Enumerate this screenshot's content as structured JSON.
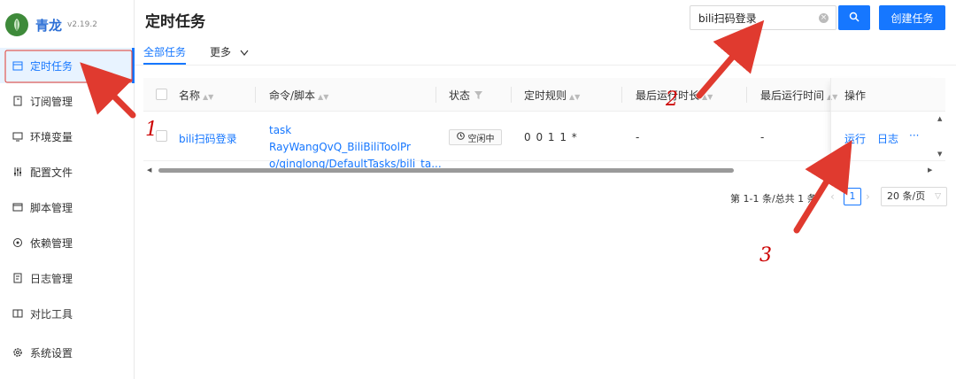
{
  "brand": {
    "name": "青龙",
    "version": "v2.19.2"
  },
  "sidebar": {
    "items": [
      {
        "label": "定时任务",
        "icon": "calendar-icon",
        "active": true
      },
      {
        "label": "订阅管理",
        "icon": "subscription-icon"
      },
      {
        "label": "环境变量",
        "icon": "monitor-icon"
      },
      {
        "label": "配置文件",
        "icon": "sliders-icon"
      },
      {
        "label": "脚本管理",
        "icon": "code-window-icon"
      },
      {
        "label": "依赖管理",
        "icon": "dependency-icon"
      },
      {
        "label": "日志管理",
        "icon": "log-icon"
      },
      {
        "label": "对比工具",
        "icon": "compare-icon"
      },
      {
        "label": "系统设置",
        "icon": "gear-icon"
      }
    ]
  },
  "header": {
    "title": "定时任务",
    "search_value": "bili扫码登录",
    "create_label": "创建任务"
  },
  "tabs": {
    "all": "全部任务",
    "more": "更多"
  },
  "table": {
    "columns": {
      "name": "名称",
      "command": "命令/脚本",
      "status": "状态",
      "schedule": "定时规则",
      "last_duration": "最后运行时长",
      "last_run": "最后运行时间",
      "actions": "操作"
    },
    "rows": [
      {
        "name": "bili扫码登录",
        "command_line1": "task RayWangQvQ_BiliBiliToolPr",
        "command_line2": "o/qinglong/DefaultTasks/bili_ta...",
        "status": "空闲中",
        "schedule": "0 0 1 1 *",
        "last_duration": "-",
        "last_run": "-",
        "action_run": "运行",
        "action_log": "日志",
        "action_more": "···"
      }
    ]
  },
  "pagination": {
    "summary": "第 1-1 条/总共 1 条",
    "current_page": "1",
    "page_size": "20 条/页"
  },
  "annotations": {
    "marker1": "1",
    "marker2": "2",
    "marker3": "3"
  },
  "colors": {
    "accent": "#1677ff",
    "annotation": "#e03a2f",
    "logo": "#3e8a3a"
  }
}
